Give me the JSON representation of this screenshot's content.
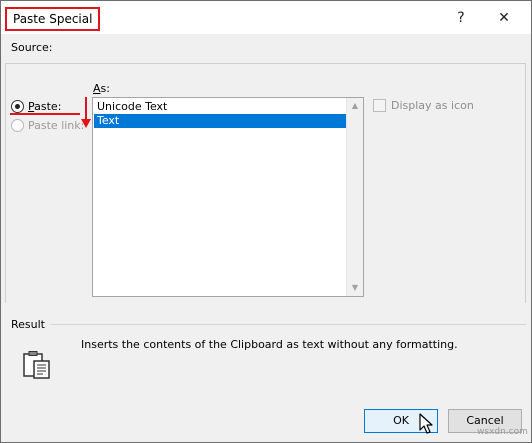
{
  "dialog": {
    "title": "Paste Special",
    "help_symbol": "?",
    "close_symbol": "✕"
  },
  "source": {
    "label": "Source:"
  },
  "paste_options": {
    "paste": {
      "label_first": "P",
      "label_rest": "aste:",
      "checked": true
    },
    "paste_link": {
      "label": "Paste link:",
      "enabled": false
    }
  },
  "as_section": {
    "label_first": "A",
    "label_rest": "s:",
    "items": [
      {
        "label": "Unicode Text",
        "selected": false
      },
      {
        "label": "Text",
        "selected": true
      }
    ]
  },
  "display_as_icon": {
    "label": "Display as icon",
    "enabled": false
  },
  "result": {
    "label": "Result",
    "description": "Inserts the contents of the Clipboard as text without any formatting.",
    "icon": "clipboard-icon"
  },
  "buttons": {
    "ok_label": "OK",
    "cancel_label": "Cancel"
  },
  "watermark": "wsxdn.com",
  "colors": {
    "highlight_red": "#e1131d",
    "selection_blue": "#0078d7"
  }
}
